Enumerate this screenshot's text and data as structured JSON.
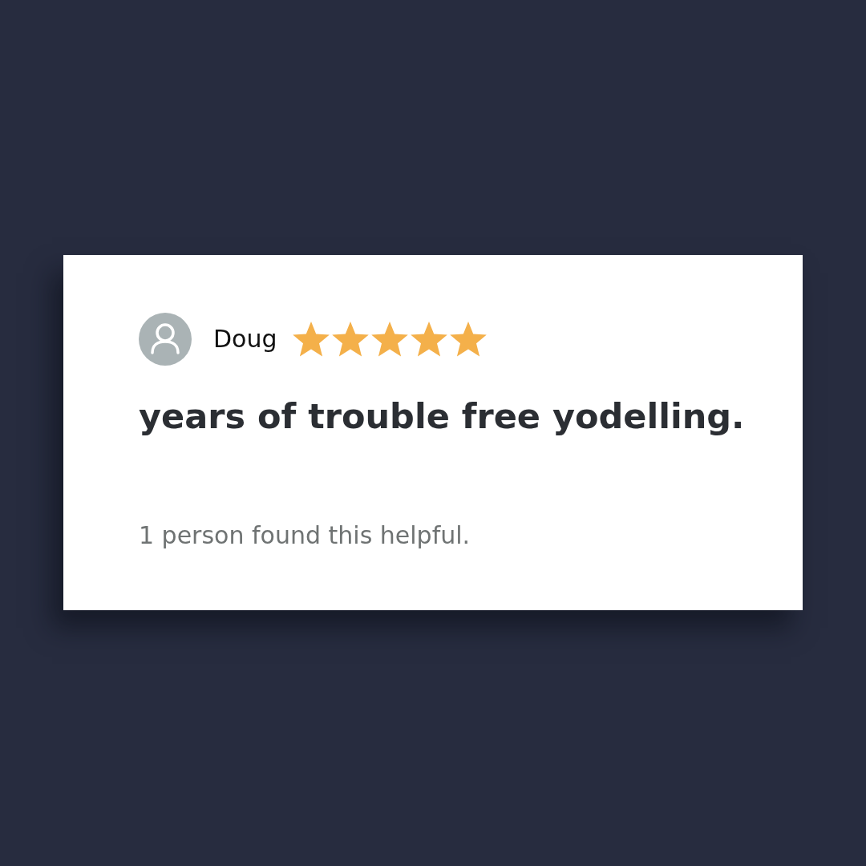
{
  "review": {
    "reviewer": "Doug",
    "stars": 5,
    "title": "years of trouble free yodelling.",
    "helpful_text": "1 person found this helpful."
  }
}
